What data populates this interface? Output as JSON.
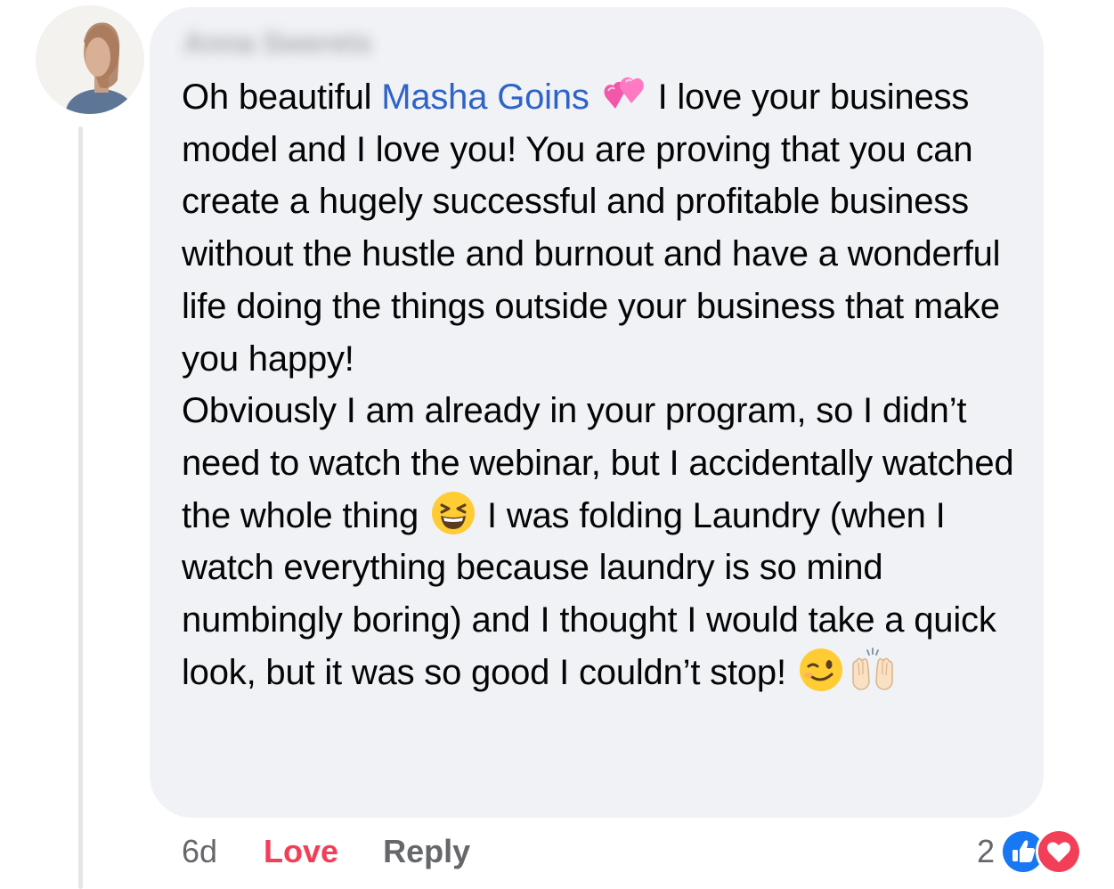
{
  "comment": {
    "author": "Anna Swerets",
    "mention": "Masha Goins",
    "intro_before": "Oh beautiful ",
    "intro_after": "I love your business model and I love you! You are proving that you can create a hugely successful and profitable business without the hustle and burnout and have a wonderful life doing the things outside your business that make you happy!",
    "p2_before": "Obviously I am already in your program, so I didn’t need to watch the webinar, but I accidentally watched the whole thing ",
    "p2_middle": "I was folding Laundry (when I watch everything because laundry is so mind numbingly boring) and I thought I would take a quick look, but it was so good I couldn’t stop! ",
    "emojis": [
      "two-hearts-icon",
      "grinning-squinting-face-icon",
      "winking-face-icon",
      "raising-hands-icon"
    ]
  },
  "actions": {
    "timestamp": "6d",
    "love_label": "Love",
    "reply_label": "Reply"
  },
  "reactions": {
    "count": "2",
    "icons": [
      "like-reaction-icon",
      "love-reaction-icon"
    ]
  },
  "colors": {
    "mention": "#2e63c8",
    "love": "#f33e58",
    "like_blue": "#1877f2",
    "bubble": "#f0f2f5",
    "secondary_text": "#65676b"
  }
}
